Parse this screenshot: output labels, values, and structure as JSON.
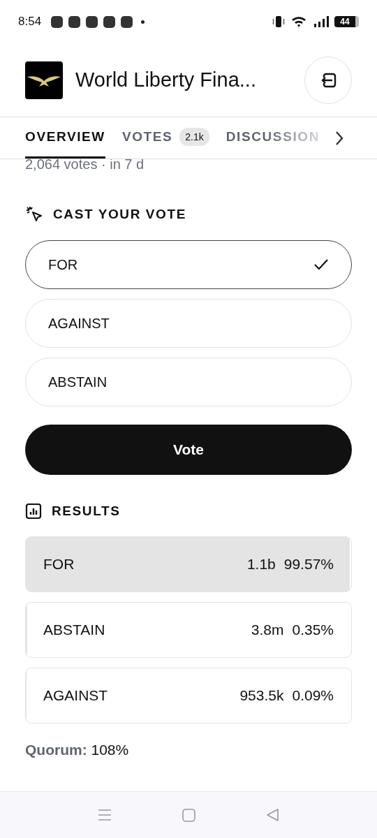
{
  "status_bar": {
    "time": "8:54",
    "battery": "44"
  },
  "header": {
    "title": "World Liberty Fina..."
  },
  "tabs": [
    {
      "label": "OVERVIEW",
      "selected": true
    },
    {
      "label": "VOTES",
      "badge": "2.1k",
      "selected": false
    },
    {
      "label": "DISCUSSION",
      "selected": false
    }
  ],
  "summary": "2,064 votes · in 7 d",
  "cast_vote": {
    "heading": "CAST YOUR VOTE",
    "options": [
      {
        "label": "FOR",
        "selected": true
      },
      {
        "label": "AGAINST",
        "selected": false
      },
      {
        "label": "ABSTAIN",
        "selected": false
      }
    ],
    "button": "Vote"
  },
  "results": {
    "heading": "RESULTS",
    "rows": [
      {
        "label": "FOR",
        "amount": "1.1b",
        "percent": "99.57%",
        "level": 0.9957
      },
      {
        "label": "ABSTAIN",
        "amount": "3.8m",
        "percent": "0.35%",
        "level": 0.0035
      },
      {
        "label": "AGAINST",
        "amount": "953.5k",
        "percent": "0.09%",
        "level": 0.0009
      }
    ],
    "quorum_label": "Quorum:",
    "quorum_value": "108%"
  }
}
